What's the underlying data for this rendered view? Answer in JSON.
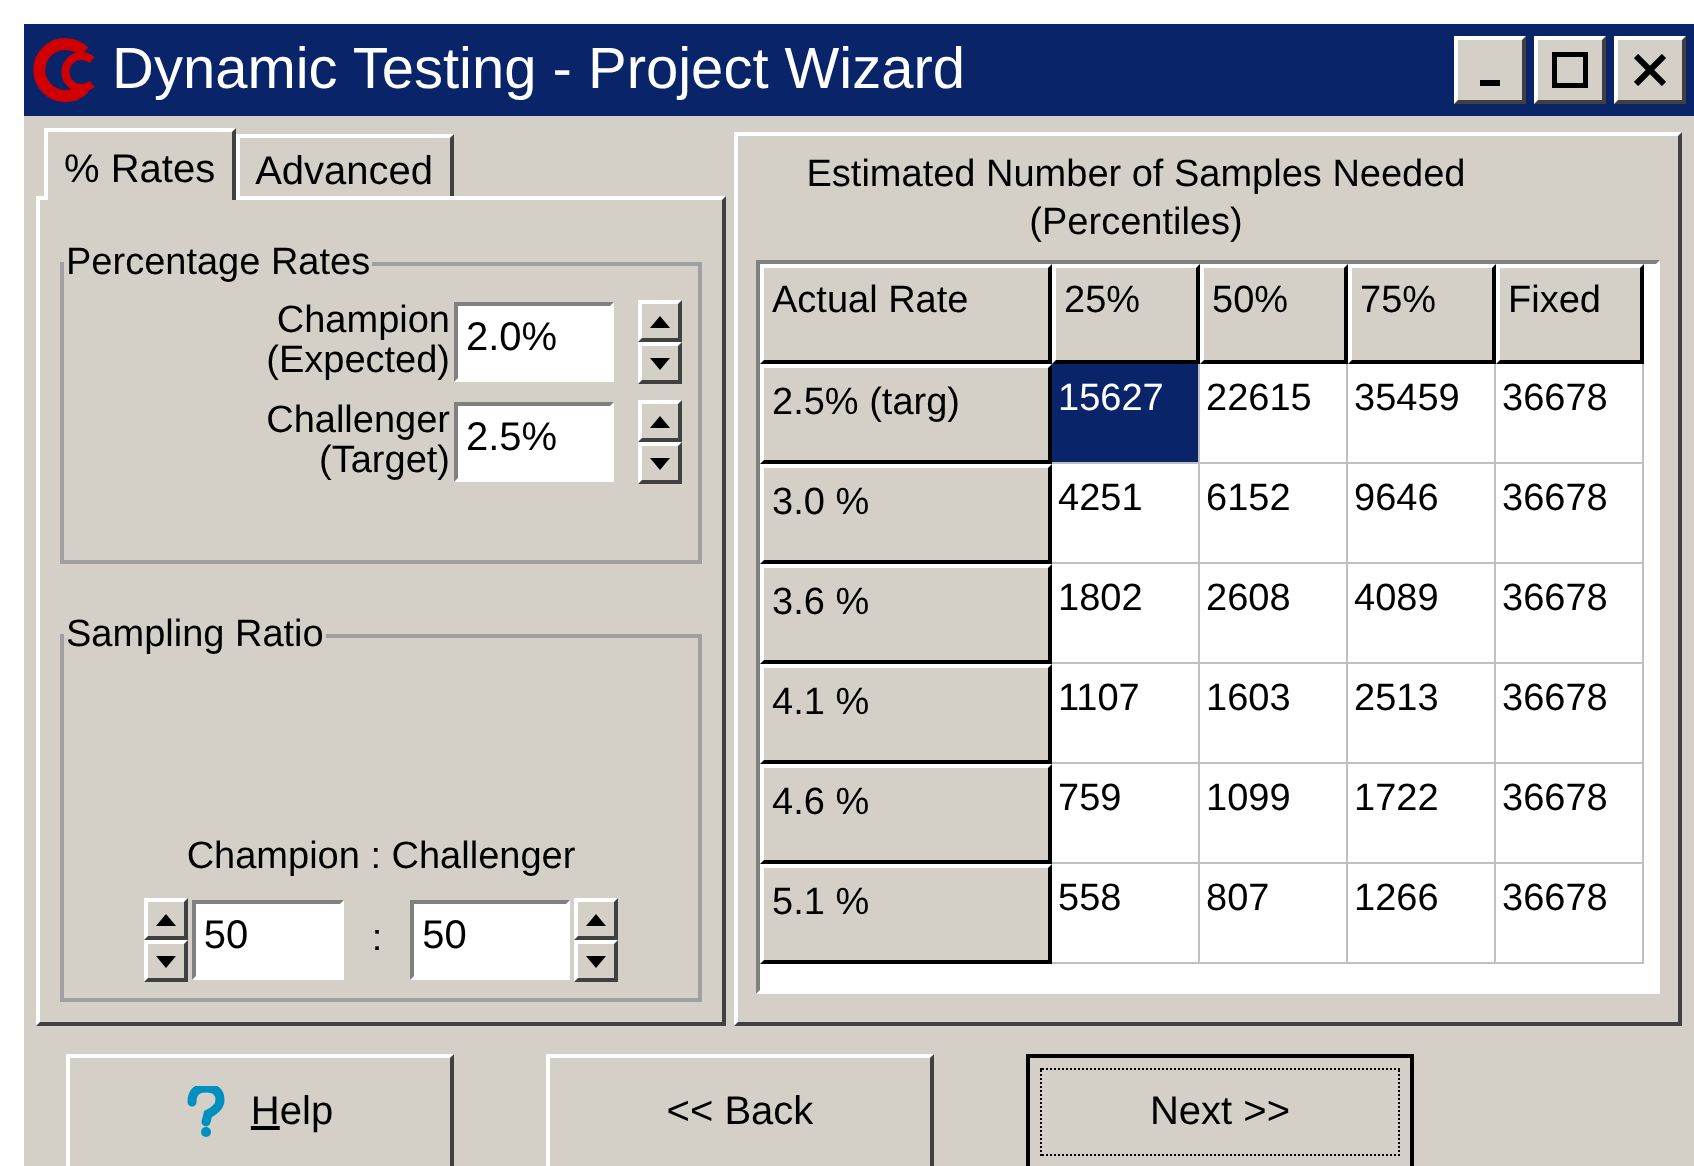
{
  "window": {
    "title": "Dynamic Testing - Project Wizard"
  },
  "tabs": [
    {
      "label": "% Rates",
      "selected": true
    },
    {
      "label": "Advanced",
      "selected": false
    }
  ],
  "percentage_rates": {
    "title": "Percentage Rates",
    "fields": [
      {
        "label_line1": "Champion",
        "label_line2": "(Expected)",
        "value": "2.0%"
      },
      {
        "label_line1": "Challenger",
        "label_line2": "(Target)",
        "value": "2.5%"
      }
    ]
  },
  "sampling_ratio": {
    "title": "Sampling Ratio",
    "caption": "Champion : Challenger",
    "left_value": "50",
    "separator": ":",
    "right_value": "50"
  },
  "table": {
    "title_line1": "Estimated Number of Samples Needed",
    "title_line2": "(Percentiles)",
    "columns": [
      "Actual Rate",
      "25%",
      "50%",
      "75%",
      "Fixed"
    ],
    "rows": [
      {
        "cells": [
          {
            "kind": "row_header",
            "text": "2.5% (targ)",
            "selected": false
          },
          {
            "kind": "value",
            "text": "15627",
            "selected": true
          },
          {
            "kind": "value",
            "text": "22615",
            "selected": false
          },
          {
            "kind": "value",
            "text": "35459",
            "selected": false
          },
          {
            "kind": "value",
            "text": "36678",
            "selected": false
          }
        ]
      },
      {
        "cells": [
          {
            "kind": "row_header",
            "text": "3.0 %",
            "selected": false
          },
          {
            "kind": "value",
            "text": "4251",
            "selected": false
          },
          {
            "kind": "value",
            "text": "6152",
            "selected": false
          },
          {
            "kind": "value",
            "text": "9646",
            "selected": false
          },
          {
            "kind": "value",
            "text": "36678",
            "selected": false
          }
        ]
      },
      {
        "cells": [
          {
            "kind": "row_header",
            "text": "3.6 %",
            "selected": false
          },
          {
            "kind": "value",
            "text": "1802",
            "selected": false
          },
          {
            "kind": "value",
            "text": "2608",
            "selected": false
          },
          {
            "kind": "value",
            "text": "4089",
            "selected": false
          },
          {
            "kind": "value",
            "text": "36678",
            "selected": false
          }
        ]
      },
      {
        "cells": [
          {
            "kind": "row_header",
            "text": "4.1 %",
            "selected": false
          },
          {
            "kind": "value",
            "text": "1107",
            "selected": false
          },
          {
            "kind": "value",
            "text": "1603",
            "selected": false
          },
          {
            "kind": "value",
            "text": "2513",
            "selected": false
          },
          {
            "kind": "value",
            "text": "36678",
            "selected": false
          }
        ]
      },
      {
        "cells": [
          {
            "kind": "row_header",
            "text": "4.6 %",
            "selected": false
          },
          {
            "kind": "value",
            "text": "759",
            "selected": false
          },
          {
            "kind": "value",
            "text": "1099",
            "selected": false
          },
          {
            "kind": "value",
            "text": "1722",
            "selected": false
          },
          {
            "kind": "value",
            "text": "36678",
            "selected": false
          }
        ]
      },
      {
        "cells": [
          {
            "kind": "row_header",
            "text": "5.1 %",
            "selected": false
          },
          {
            "kind": "value",
            "text": "558",
            "selected": false
          },
          {
            "kind": "value",
            "text": "807",
            "selected": false
          },
          {
            "kind": "value",
            "text": "1266",
            "selected": false
          },
          {
            "kind": "value",
            "text": "36678",
            "selected": false
          }
        ]
      }
    ]
  },
  "buttons": [
    {
      "kind": "help",
      "label": "Help",
      "focused": false
    },
    {
      "kind": "plain",
      "label": "<< Back",
      "focused": false
    },
    {
      "kind": "plain",
      "label": "Next >>",
      "focused": true
    }
  ]
}
